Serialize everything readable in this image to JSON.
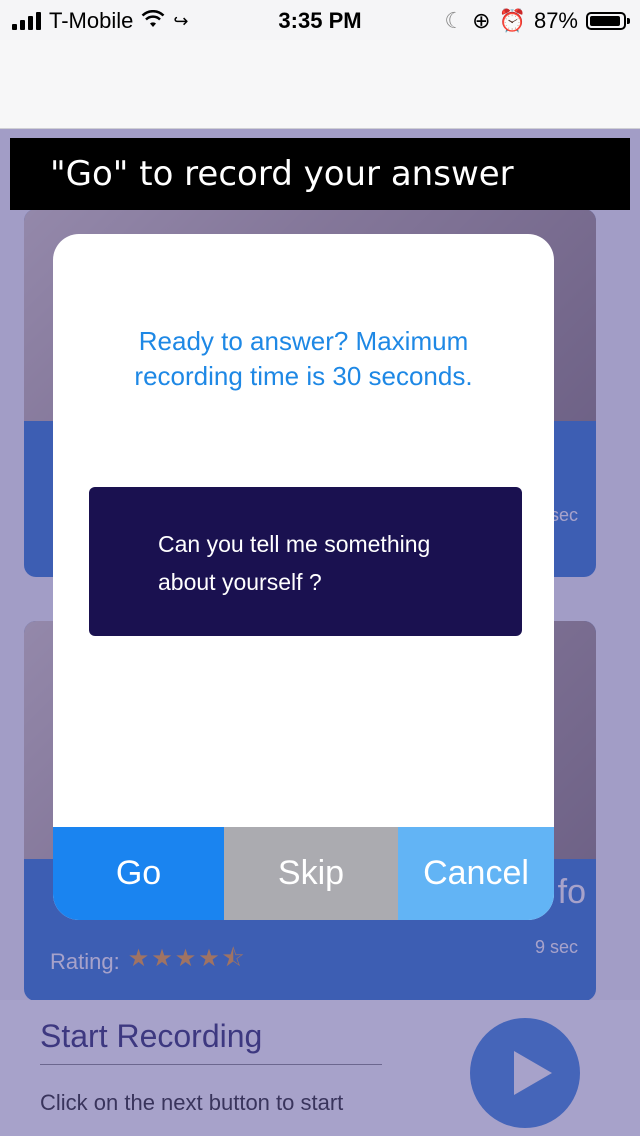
{
  "status_bar": {
    "carrier": "T-Mobile",
    "time": "3:35 PM",
    "battery": "87%",
    "battery_level": 0.87
  },
  "caption": "\"Go\" to record your answer",
  "background": {
    "cards": [
      {
        "duration": "sec"
      },
      {
        "question_fragment": "ey fo",
        "rating_label": "Rating:",
        "rating_value": 4.5,
        "rating_stars": "★★★★⯪",
        "duration": "9 sec"
      }
    ],
    "bottom": {
      "title": "Start Recording",
      "subtitle": "Click on the next button to start"
    }
  },
  "dialog": {
    "prompt": "Ready to answer? Maximum recording time is 30 seconds.",
    "question": "Can you tell me something about yourself ?",
    "buttons": {
      "go": "Go",
      "skip": "Skip",
      "cancel": "Cancel"
    }
  },
  "colors": {
    "primary_blue": "#1a84f0",
    "question_bg": "#1a1150",
    "prompt_text": "#1e88e5",
    "skip_gray": "#ababb0",
    "cancel_blue": "#62b4f5"
  }
}
